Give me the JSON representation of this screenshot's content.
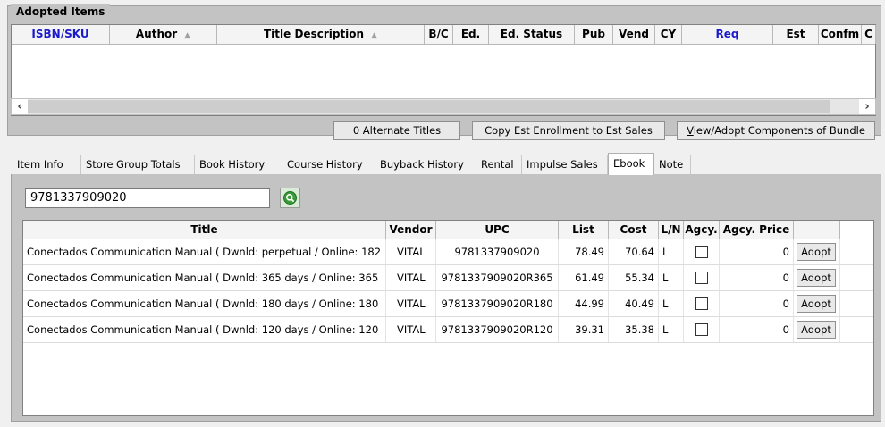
{
  "adopted_items": {
    "title": "Adopted Items",
    "columns": [
      {
        "label": "ISBN/SKU",
        "blue": true,
        "sort": false
      },
      {
        "label": "Author",
        "blue": false,
        "sort": true
      },
      {
        "label": "Title Description",
        "blue": false,
        "sort": true
      },
      {
        "label": "B/C",
        "blue": false,
        "sort": false
      },
      {
        "label": "Ed.",
        "blue": false,
        "sort": false
      },
      {
        "label": "Ed. Status",
        "blue": false,
        "sort": false
      },
      {
        "label": "Pub",
        "blue": false,
        "sort": false
      },
      {
        "label": "Vend",
        "blue": false,
        "sort": false
      },
      {
        "label": "CY",
        "blue": false,
        "sort": false
      },
      {
        "label": "Req",
        "blue": true,
        "sort": false
      },
      {
        "label": "Est",
        "blue": false,
        "sort": false
      },
      {
        "label": "Confm",
        "blue": false,
        "sort": false
      },
      {
        "label": "C",
        "blue": false,
        "sort": false
      }
    ],
    "sort_arrow": "▲",
    "scroll_left": "‹",
    "scroll_right": "›"
  },
  "buttons": {
    "alternate_titles": "0 Alternate Titles",
    "copy_est": "Copy Est Enrollment to Est Sales",
    "view_adopt_hotkey": "V",
    "view_adopt_rest": "iew/Adopt Components of Bundle"
  },
  "tabs": [
    {
      "label": "Item Info",
      "active": false
    },
    {
      "label": "Store Group Totals",
      "active": false
    },
    {
      "label": "Book History",
      "active": false
    },
    {
      "label": "Course History",
      "active": false
    },
    {
      "label": "Buyback History",
      "active": false
    },
    {
      "label": "Rental",
      "active": false
    },
    {
      "label": "Impulse Sales",
      "active": false
    },
    {
      "label": "Ebook",
      "active": true
    },
    {
      "label": "Note",
      "active": false
    }
  ],
  "ebook": {
    "search_value": "9781337909020",
    "columns": [
      "Title",
      "Vendor",
      "UPC",
      "List",
      "Cost",
      "L/N",
      "Agcy.",
      "Agcy. Price",
      ""
    ],
    "adopt_label": "Adopt",
    "rows": [
      {
        "title": "Conectados Communication Manual ( Dwnld: perpetual / Online: 182",
        "vendor": "VITAL",
        "upc": "9781337909020",
        "list": "78.49",
        "cost": "70.64",
        "ln": "L",
        "agcy_checked": false,
        "agcy_price": "0"
      },
      {
        "title": "Conectados Communication Manual ( Dwnld: 365 days / Online: 365",
        "vendor": "VITAL",
        "upc": "9781337909020R365",
        "list": "61.49",
        "cost": "55.34",
        "ln": "L",
        "agcy_checked": false,
        "agcy_price": "0"
      },
      {
        "title": "Conectados Communication Manual ( Dwnld: 180 days / Online: 180",
        "vendor": "VITAL",
        "upc": "9781337909020R180",
        "list": "44.99",
        "cost": "40.49",
        "ln": "L",
        "agcy_checked": false,
        "agcy_price": "0"
      },
      {
        "title": "Conectados Communication Manual ( Dwnld: 120 days / Online: 120",
        "vendor": "VITAL",
        "upc": "9781337909020R120",
        "list": "39.31",
        "cost": "35.38",
        "ln": "L",
        "agcy_checked": false,
        "agcy_price": "0"
      }
    ]
  },
  "colors": {
    "header_blue": "#1a1acc",
    "group_bg": "#c3c3c3"
  },
  "icons": {
    "search_button": "refresh-search-icon"
  }
}
